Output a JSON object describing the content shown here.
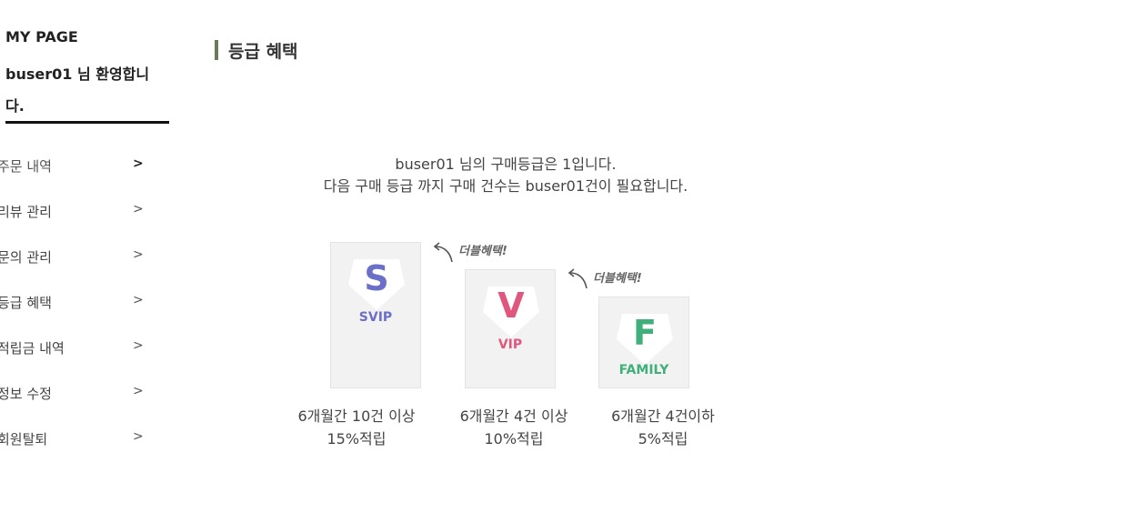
{
  "sidebar": {
    "title": "MY PAGE",
    "welcome": "buser01 님 환영합니다.",
    "items": [
      {
        "label": "주문 내역",
        "arrow": ">"
      },
      {
        "label": "리뷰 관리",
        "arrow": ">"
      },
      {
        "label": "문의 관리",
        "arrow": ">"
      },
      {
        "label": "등급 혜택",
        "arrow": ">"
      },
      {
        "label": "적립금 내역",
        "arrow": ">"
      },
      {
        "label": "정보 수정",
        "arrow": ">"
      },
      {
        "label": "회원탈퇴",
        "arrow": ">"
      }
    ]
  },
  "main": {
    "section_title": "등급 혜택",
    "info_line1": "buser01 님의 구매등급은 1입니다.",
    "info_line2": "다음 구매 등급 까지 구매 건수는 buser01건이 필요합니다.",
    "double_benefit": "더블혜택!",
    "tiers": [
      {
        "letter": "S",
        "name": "SVIP",
        "color": "#6a6fc8",
        "condition": "6개월간 10건 이상",
        "reward": "15%적립"
      },
      {
        "letter": "V",
        "name": "VIP",
        "color": "#e0567f",
        "condition": "6개월간 4건 이상",
        "reward": "10%적립"
      },
      {
        "letter": "F",
        "name": "FAMILY",
        "color": "#3fb07a",
        "condition": "6개월간 4건이하",
        "reward": "5%적립"
      }
    ]
  }
}
